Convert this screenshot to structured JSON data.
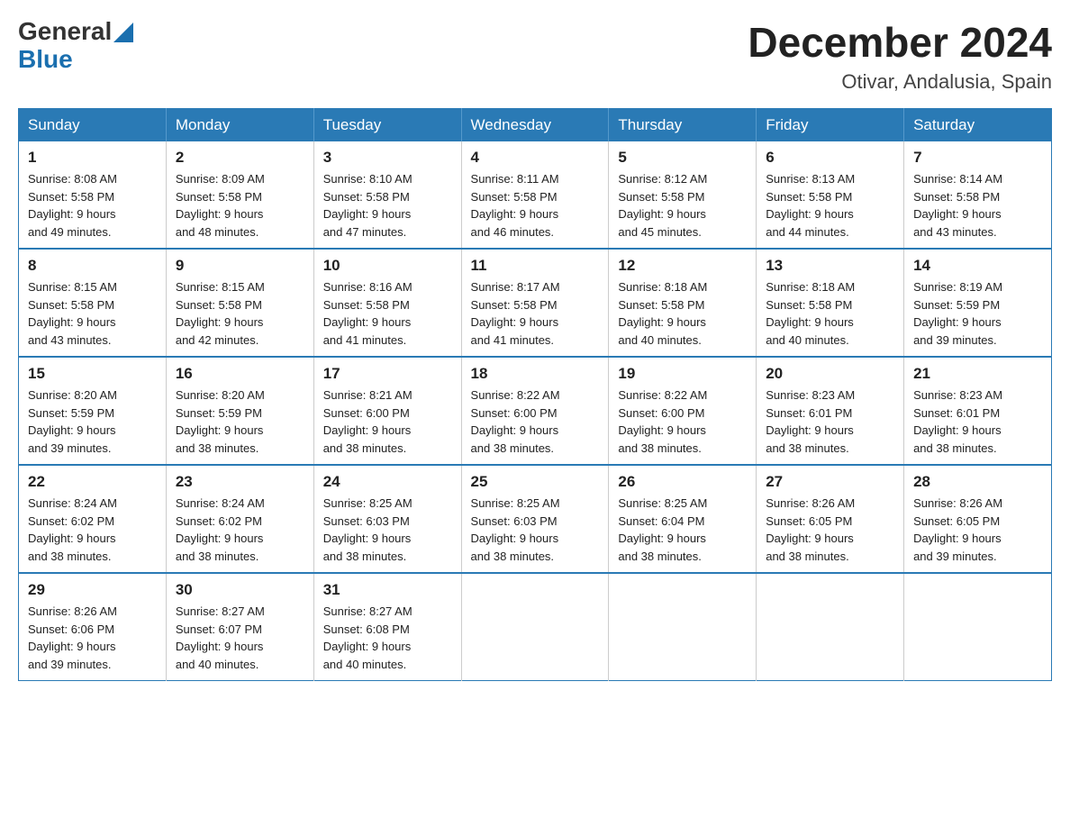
{
  "header": {
    "logo": {
      "general": "General",
      "blue": "Blue"
    },
    "month_year": "December 2024",
    "location": "Otivar, Andalusia, Spain"
  },
  "days_of_week": [
    "Sunday",
    "Monday",
    "Tuesday",
    "Wednesday",
    "Thursday",
    "Friday",
    "Saturday"
  ],
  "weeks": [
    [
      {
        "day": "1",
        "sunrise": "8:08 AM",
        "sunset": "5:58 PM",
        "daylight": "9 hours and 49 minutes."
      },
      {
        "day": "2",
        "sunrise": "8:09 AM",
        "sunset": "5:58 PM",
        "daylight": "9 hours and 48 minutes."
      },
      {
        "day": "3",
        "sunrise": "8:10 AM",
        "sunset": "5:58 PM",
        "daylight": "9 hours and 47 minutes."
      },
      {
        "day": "4",
        "sunrise": "8:11 AM",
        "sunset": "5:58 PM",
        "daylight": "9 hours and 46 minutes."
      },
      {
        "day": "5",
        "sunrise": "8:12 AM",
        "sunset": "5:58 PM",
        "daylight": "9 hours and 45 minutes."
      },
      {
        "day": "6",
        "sunrise": "8:13 AM",
        "sunset": "5:58 PM",
        "daylight": "9 hours and 44 minutes."
      },
      {
        "day": "7",
        "sunrise": "8:14 AM",
        "sunset": "5:58 PM",
        "daylight": "9 hours and 43 minutes."
      }
    ],
    [
      {
        "day": "8",
        "sunrise": "8:15 AM",
        "sunset": "5:58 PM",
        "daylight": "9 hours and 43 minutes."
      },
      {
        "day": "9",
        "sunrise": "8:15 AM",
        "sunset": "5:58 PM",
        "daylight": "9 hours and 42 minutes."
      },
      {
        "day": "10",
        "sunrise": "8:16 AM",
        "sunset": "5:58 PM",
        "daylight": "9 hours and 41 minutes."
      },
      {
        "day": "11",
        "sunrise": "8:17 AM",
        "sunset": "5:58 PM",
        "daylight": "9 hours and 41 minutes."
      },
      {
        "day": "12",
        "sunrise": "8:18 AM",
        "sunset": "5:58 PM",
        "daylight": "9 hours and 40 minutes."
      },
      {
        "day": "13",
        "sunrise": "8:18 AM",
        "sunset": "5:58 PM",
        "daylight": "9 hours and 40 minutes."
      },
      {
        "day": "14",
        "sunrise": "8:19 AM",
        "sunset": "5:59 PM",
        "daylight": "9 hours and 39 minutes."
      }
    ],
    [
      {
        "day": "15",
        "sunrise": "8:20 AM",
        "sunset": "5:59 PM",
        "daylight": "9 hours and 39 minutes."
      },
      {
        "day": "16",
        "sunrise": "8:20 AM",
        "sunset": "5:59 PM",
        "daylight": "9 hours and 38 minutes."
      },
      {
        "day": "17",
        "sunrise": "8:21 AM",
        "sunset": "6:00 PM",
        "daylight": "9 hours and 38 minutes."
      },
      {
        "day": "18",
        "sunrise": "8:22 AM",
        "sunset": "6:00 PM",
        "daylight": "9 hours and 38 minutes."
      },
      {
        "day": "19",
        "sunrise": "8:22 AM",
        "sunset": "6:00 PM",
        "daylight": "9 hours and 38 minutes."
      },
      {
        "day": "20",
        "sunrise": "8:23 AM",
        "sunset": "6:01 PM",
        "daylight": "9 hours and 38 minutes."
      },
      {
        "day": "21",
        "sunrise": "8:23 AM",
        "sunset": "6:01 PM",
        "daylight": "9 hours and 38 minutes."
      }
    ],
    [
      {
        "day": "22",
        "sunrise": "8:24 AM",
        "sunset": "6:02 PM",
        "daylight": "9 hours and 38 minutes."
      },
      {
        "day": "23",
        "sunrise": "8:24 AM",
        "sunset": "6:02 PM",
        "daylight": "9 hours and 38 minutes."
      },
      {
        "day": "24",
        "sunrise": "8:25 AM",
        "sunset": "6:03 PM",
        "daylight": "9 hours and 38 minutes."
      },
      {
        "day": "25",
        "sunrise": "8:25 AM",
        "sunset": "6:03 PM",
        "daylight": "9 hours and 38 minutes."
      },
      {
        "day": "26",
        "sunrise": "8:25 AM",
        "sunset": "6:04 PM",
        "daylight": "9 hours and 38 minutes."
      },
      {
        "day": "27",
        "sunrise": "8:26 AM",
        "sunset": "6:05 PM",
        "daylight": "9 hours and 38 minutes."
      },
      {
        "day": "28",
        "sunrise": "8:26 AM",
        "sunset": "6:05 PM",
        "daylight": "9 hours and 39 minutes."
      }
    ],
    [
      {
        "day": "29",
        "sunrise": "8:26 AM",
        "sunset": "6:06 PM",
        "daylight": "9 hours and 39 minutes."
      },
      {
        "day": "30",
        "sunrise": "8:27 AM",
        "sunset": "6:07 PM",
        "daylight": "9 hours and 40 minutes."
      },
      {
        "day": "31",
        "sunrise": "8:27 AM",
        "sunset": "6:08 PM",
        "daylight": "9 hours and 40 minutes."
      },
      null,
      null,
      null,
      null
    ]
  ],
  "labels": {
    "sunrise": "Sunrise:",
    "sunset": "Sunset:",
    "daylight": "Daylight:"
  }
}
